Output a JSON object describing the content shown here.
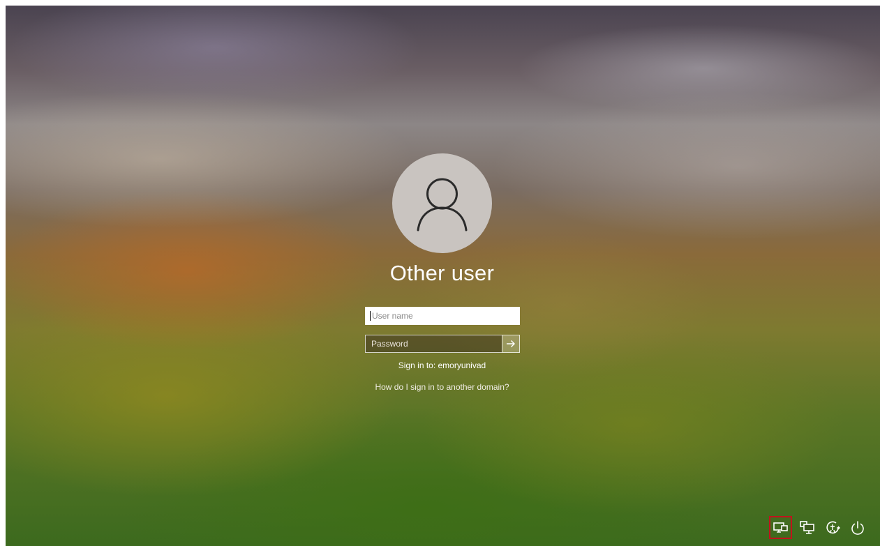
{
  "user": {
    "name": "Other user",
    "avatar_icon": "user-silhouette-icon"
  },
  "form": {
    "username_placeholder": "User name",
    "password_placeholder": "Password",
    "submit_icon": "arrow-right-icon"
  },
  "domain": {
    "sign_in_to": "Sign in to: emoryunivad",
    "help_link": "How do I sign in to another domain?"
  },
  "tray": {
    "icons": [
      "display-switch-icon",
      "network-icon",
      "accessibility-icon",
      "power-icon"
    ],
    "selected": "display-switch-icon",
    "selected_color": "#c0141c"
  }
}
